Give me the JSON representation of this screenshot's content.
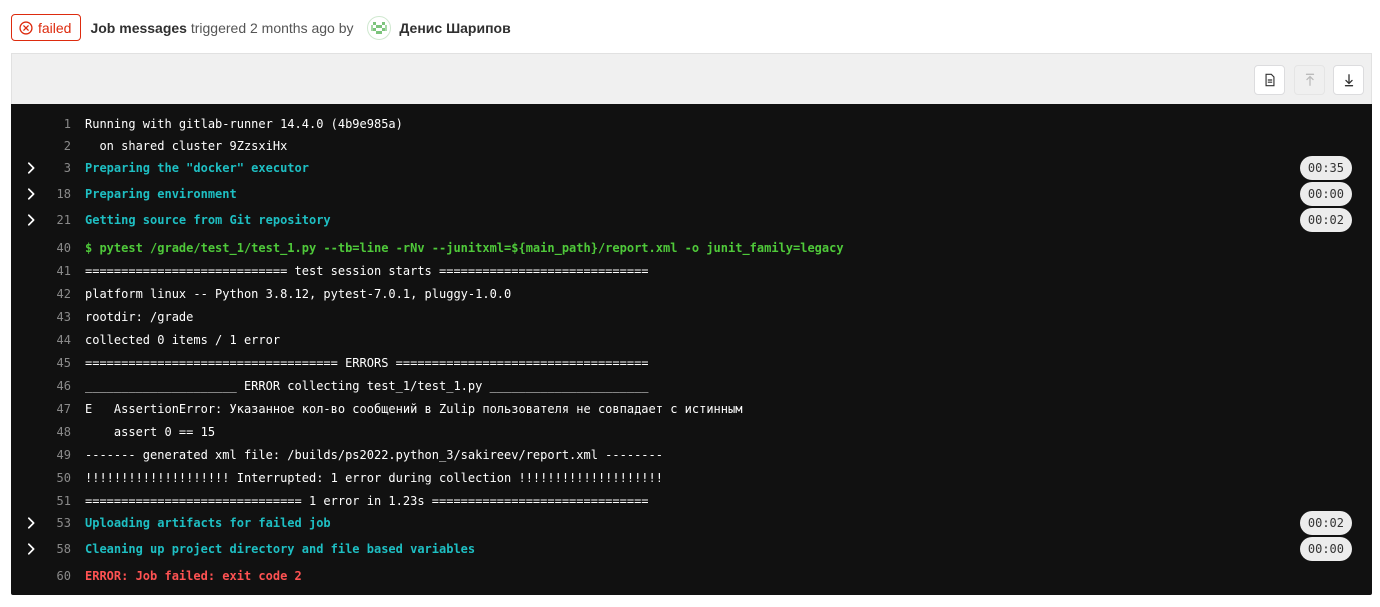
{
  "header": {
    "status": "failed",
    "job_name": "Job messages",
    "triggered_text": " triggered 2 months ago by ",
    "author": "Денис Шарипов",
    "status_color": "#dd2b0e"
  },
  "toolbar": {
    "buttons": [
      {
        "icon": "raw-log-icon"
      },
      {
        "icon": "scroll-top-icon",
        "disabled": true
      },
      {
        "icon": "scroll-bottom-icon"
      }
    ]
  },
  "log": {
    "lines": [
      {
        "num": "1",
        "text": "Running with gitlab-runner 14.4.0 (4b9e985a)",
        "style": "normal"
      },
      {
        "num": "2",
        "text": "  on shared cluster 9ZzsxiHx",
        "style": "normal"
      },
      {
        "num": "3",
        "text": "Preparing the \"docker\" executor",
        "style": "section",
        "duration": "00:35"
      },
      {
        "num": "18",
        "text": "Preparing environment",
        "style": "section",
        "duration": "00:00"
      },
      {
        "num": "21",
        "text": "Getting source from Git repository",
        "style": "section",
        "duration": "00:02"
      },
      {
        "num": "40",
        "text": "$ pytest /grade/test_1/test_1.py --tb=line -rNv --junitxml=${main_path}/report.xml -o junit_family=legacy",
        "style": "cmd"
      },
      {
        "num": "41",
        "text": "============================ test session starts =============================",
        "style": "normal"
      },
      {
        "num": "42",
        "text": "platform linux -- Python 3.8.12, pytest-7.0.1, pluggy-1.0.0",
        "style": "normal"
      },
      {
        "num": "43",
        "text": "rootdir: /grade",
        "style": "normal"
      },
      {
        "num": "44",
        "text": "collected 0 items / 1 error",
        "style": "normal"
      },
      {
        "num": "45",
        "text": "=================================== ERRORS ===================================",
        "style": "normal"
      },
      {
        "num": "46",
        "text": "_____________________ ERROR collecting test_1/test_1.py ______________________",
        "style": "normal"
      },
      {
        "num": "47",
        "text": "E   AssertionError: Указанное кол-во сообщений в Zulip пользователя не совпадает с истинным",
        "style": "normal"
      },
      {
        "num": "48",
        "text": "    assert 0 == 15",
        "style": "normal"
      },
      {
        "num": "49",
        "text": "------- generated xml file: /builds/ps2022.python_3/sakireev/report.xml --------",
        "style": "normal"
      },
      {
        "num": "50",
        "text": "!!!!!!!!!!!!!!!!!!!! Interrupted: 1 error during collection !!!!!!!!!!!!!!!!!!!!",
        "style": "normal"
      },
      {
        "num": "51",
        "text": "============================== 1 error in 1.23s ==============================",
        "style": "normal"
      },
      {
        "num": "53",
        "text": "Uploading artifacts for failed job",
        "style": "section",
        "duration": "00:02"
      },
      {
        "num": "58",
        "text": "Cleaning up project directory and file based variables",
        "style": "section",
        "duration": "00:00"
      },
      {
        "num": "60",
        "text": "ERROR: Job failed: exit code 2",
        "style": "err"
      }
    ]
  }
}
